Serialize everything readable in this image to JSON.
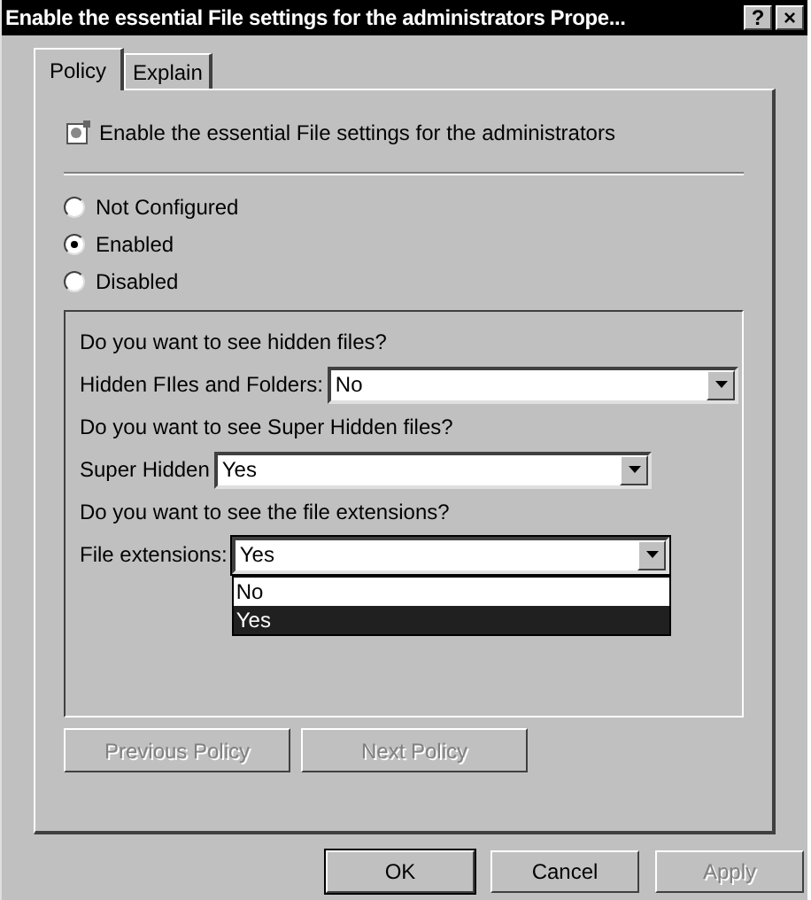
{
  "window": {
    "title": "Enable the essential File settings for the administrators Prope...",
    "title_buttons": [
      "?",
      "×"
    ]
  },
  "tabs": [
    {
      "label": "Policy",
      "selected": true
    },
    {
      "label": "Explain",
      "selected": false
    }
  ],
  "policy_name": "Enable the essential File settings for the administrators",
  "options": [
    {
      "label": "Not Configured",
      "selected": false
    },
    {
      "label": "Enabled",
      "selected": true
    },
    {
      "label": "Disabled",
      "selected": false
    }
  ],
  "settings": [
    {
      "question": "Do you want to see hidden files?",
      "label": "Hidden FIles and Folders:",
      "value": "No",
      "expanded": false
    },
    {
      "question": "Do you want to see Super Hidden files?",
      "label": "Super Hidden",
      "value": "Yes",
      "expanded": false
    },
    {
      "question": "Do you want to see the file extensions?",
      "label": "File extensions:",
      "value": "Yes",
      "expanded": true,
      "list": [
        {
          "label": "No",
          "selected": false
        },
        {
          "label": "Yes",
          "selected": true
        }
      ]
    }
  ],
  "nav_buttons": [
    {
      "label": "Previous Policy",
      "disabled": true
    },
    {
      "label": "Next Policy",
      "disabled": true
    }
  ],
  "buttons": [
    {
      "label": "OK",
      "disabled": false,
      "default": true
    },
    {
      "label": "Cancel",
      "disabled": false,
      "default": false
    },
    {
      "label": "Apply",
      "disabled": true,
      "default": false
    }
  ]
}
